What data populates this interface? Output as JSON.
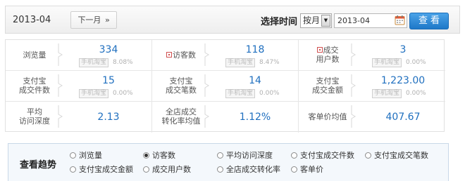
{
  "topbar": {
    "current_period": "2013-04",
    "next_label": "下一月",
    "next_chevron": "»",
    "select_time_label": "选择时间",
    "period_select_value": "按月",
    "date_value": "2013-04",
    "search_label": "查看"
  },
  "stats": {
    "pv": {
      "label": "浏览量",
      "value": "334",
      "badge": "手机淘宝",
      "pct": "8.08%"
    },
    "uv": {
      "label": "访客数",
      "value": "118",
      "badge": "手机淘宝",
      "pct": "8.47%"
    },
    "buyers": {
      "label_line1": "成交",
      "label_line2": "用户数",
      "value": "3",
      "badge": "手机淘宝",
      "pct": "0.00%"
    },
    "alipay_items": {
      "label_line1": "支付宝",
      "label_line2": "成交件数",
      "value": "15",
      "badge": "手机淘宝",
      "pct": "0.00%"
    },
    "alipay_orders": {
      "label_line1": "支付宝",
      "label_line2": "成交笔数",
      "value": "14",
      "badge": "手机淘宝",
      "pct": "0.00%"
    },
    "alipay_amount": {
      "label_line1": "支付宝",
      "label_line2": "成交金额",
      "value": "1,223.00",
      "badge": "手机淘宝",
      "pct": "0.00%"
    },
    "avg_depth": {
      "label_line1": "平均",
      "label_line2": "访问深度",
      "value": "2.13"
    },
    "conv_rate": {
      "label_line1": "全店成交",
      "label_line2": "转化率均值",
      "value": "1.12%"
    },
    "avg_price": {
      "label": "客单价均值",
      "value": "407.67"
    }
  },
  "trend": {
    "title": "查看趋势",
    "options": [
      "浏览量",
      "访客数",
      "平均访问深度",
      "支付宝成交件数",
      "支付宝成交笔数",
      "支付宝成交金额",
      "成交用户数",
      "全店成交转化率",
      "客单价"
    ],
    "selected": "访客数"
  },
  "colors": {
    "accent": "#1f6fbf",
    "button": "#2b88d8",
    "panel_bg": "#f4f8fc"
  }
}
